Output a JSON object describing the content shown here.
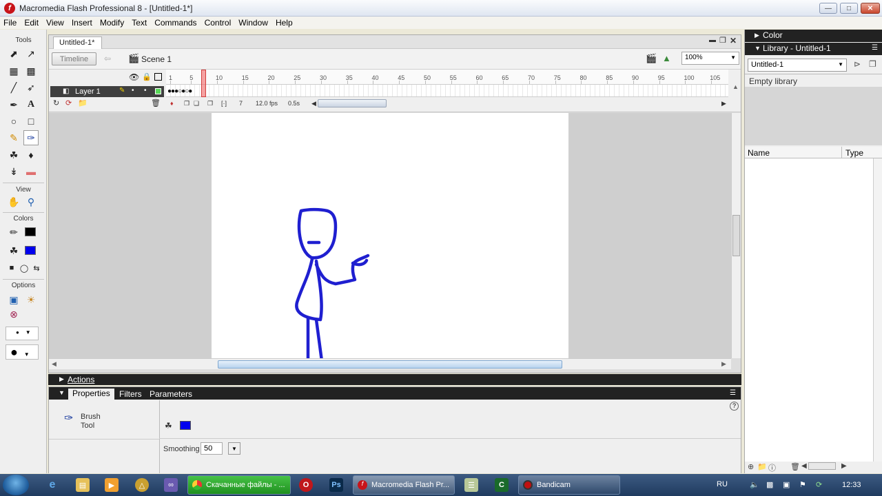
{
  "window": {
    "title": "Macromedia Flash Professional 8 - [Untitled-1*]"
  },
  "menu": [
    "File",
    "Edit",
    "View",
    "Insert",
    "Modify",
    "Text",
    "Commands",
    "Control",
    "Window",
    "Help"
  ],
  "tools": {
    "header": "Tools",
    "view_header": "View",
    "colors_header": "Colors",
    "options_header": "Options"
  },
  "document": {
    "tab": "Untitled-1*",
    "timeline_button": "Timeline",
    "scene": "Scene 1",
    "zoom": "100%"
  },
  "timeline": {
    "layer": "Layer 1",
    "frame_numbers": [
      "1",
      "5",
      "10",
      "15",
      "20",
      "25",
      "30",
      "35",
      "40",
      "45",
      "50",
      "55",
      "60",
      "65",
      "70",
      "75",
      "80",
      "85",
      "90",
      "95",
      "100",
      "105"
    ],
    "current_frame": "7",
    "fps": "12.0 fps",
    "elapsed": "0.5s"
  },
  "actions": {
    "label": "Actions"
  },
  "properties": {
    "tabs": [
      "Properties",
      "Filters",
      "Parameters"
    ],
    "tool_name": "Brush Tool",
    "smoothing_label": "Smoothing",
    "smoothing_value": "50"
  },
  "right_panels": {
    "color_header": "Color",
    "library_header": "Library - Untitled-1",
    "library_select": "Untitled-1",
    "library_empty": "Empty library",
    "col_name": "Name",
    "col_type": "Type"
  },
  "taskbar": {
    "tasks": [
      "Скачанные файлы - ...",
      "Macromedia Flash Pr...",
      "Bandicam"
    ],
    "lang": "RU",
    "clock": "12:33"
  },
  "colors": {
    "stroke": "#000000",
    "fill": "#0000ee",
    "drawing": "#1f1fd0"
  }
}
